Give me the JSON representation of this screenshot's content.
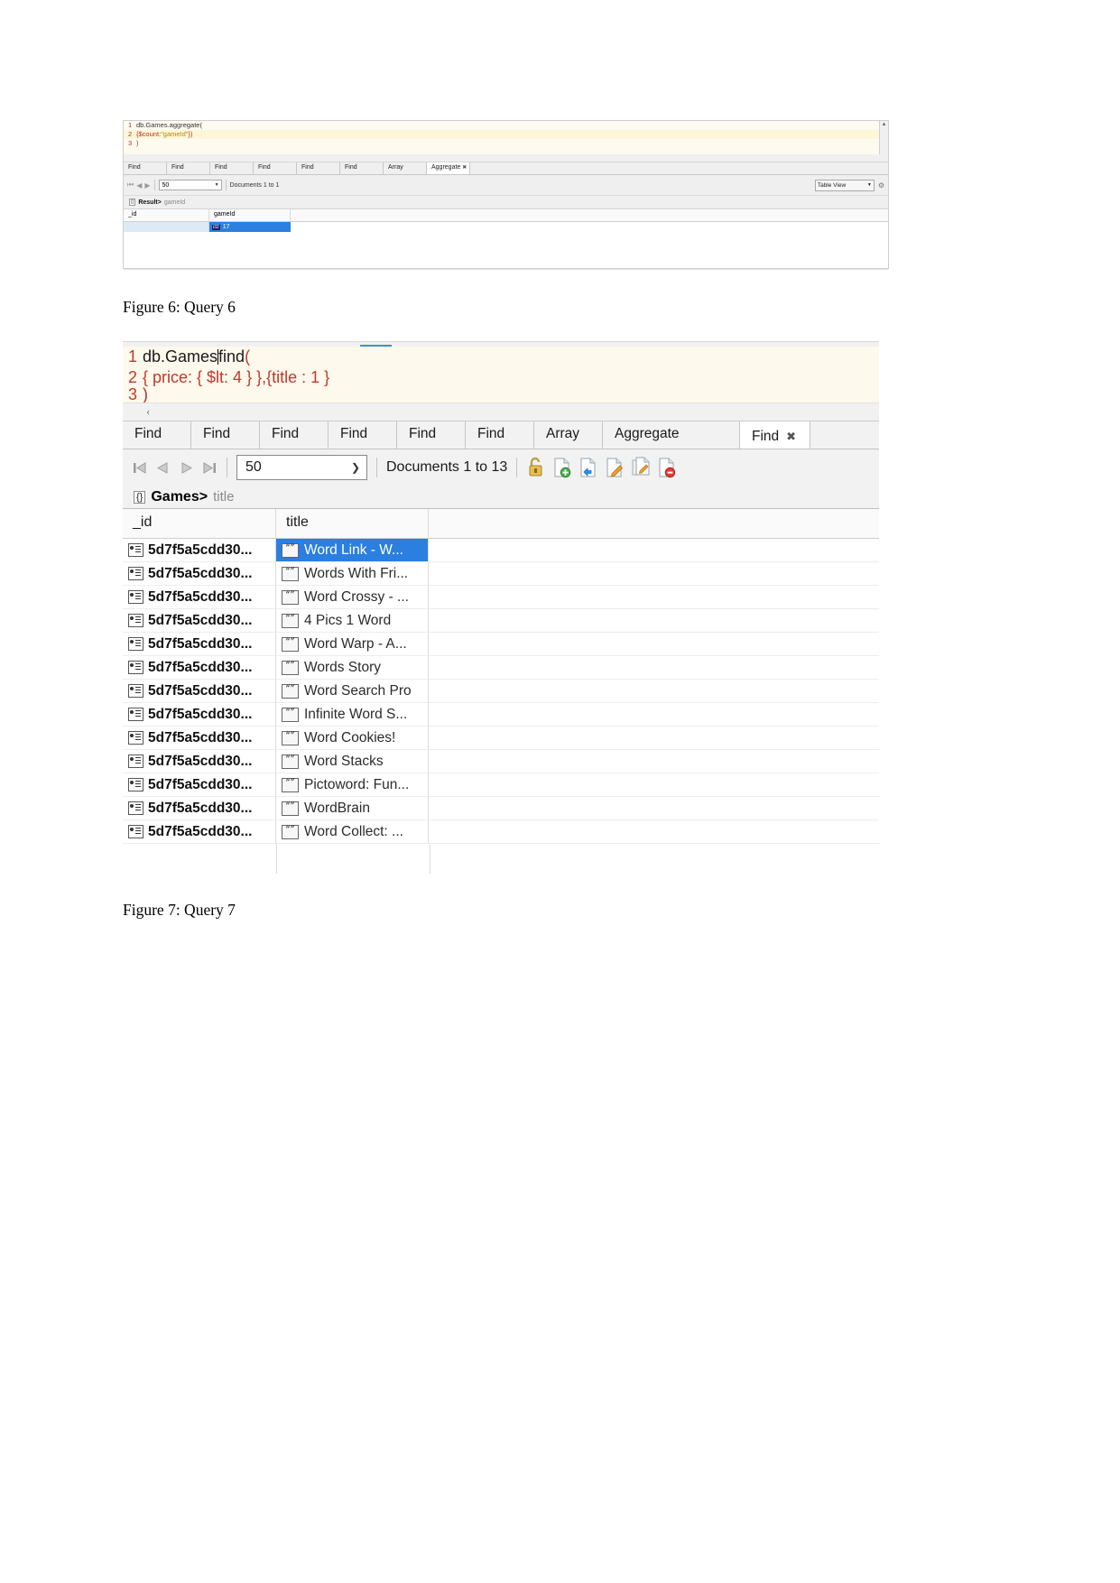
{
  "figure6": {
    "editor": {
      "line1_number": "1",
      "line1_text": "db.Games.aggregate(",
      "line2_number": "2",
      "line2_prefix": "{$count:",
      "line2_string": "\"gameId\"",
      "line2_suffix": "})",
      "line3_number": "3",
      "line3_text": ")"
    },
    "tabs": [
      {
        "label": "Find",
        "active": false
      },
      {
        "label": "Find",
        "active": false
      },
      {
        "label": "Find",
        "active": false
      },
      {
        "label": "Find",
        "active": false
      },
      {
        "label": "Find",
        "active": false
      },
      {
        "label": "Find",
        "active": false
      },
      {
        "label": "Array",
        "active": false
      },
      {
        "label": "Aggregate",
        "active": true,
        "close_icon": "close-icon"
      }
    ],
    "toolbar": {
      "first_icon": "first-page-icon",
      "prev_icon": "previous-page-icon",
      "next_icon": "next-page-icon",
      "page_size": "50",
      "documents_label": "Documents 1 to 1",
      "view_mode": "Table View",
      "gear_icon": "gear-icon"
    },
    "breadcrumb": {
      "type_icon": "{}",
      "collection": "Result>",
      "field": "gameId"
    },
    "grid": {
      "columns": [
        "_id",
        "gameId"
      ],
      "rows": [
        {
          "id": "",
          "type_badge": "i32",
          "value": "17",
          "selected": true
        }
      ]
    }
  },
  "caption6": "Figure 6: Query 6",
  "figure7": {
    "editor": {
      "line1_number": "1",
      "line1_text_a": "db.Games",
      "line1_text_b": "find",
      "line1_paren": "(",
      "line2_number": "2",
      "line2_text": "{ price: { $lt: 4 } },{title : 1 }",
      "line3_number": "3",
      "line3_text": ")",
      "scroll_chevron": "chevron-left-icon"
    },
    "tabs": [
      {
        "label": "Find",
        "active": false
      },
      {
        "label": "Find",
        "active": false
      },
      {
        "label": "Find",
        "active": false
      },
      {
        "label": "Find",
        "active": false
      },
      {
        "label": "Find",
        "active": false
      },
      {
        "label": "Find",
        "active": false
      },
      {
        "label": "Array",
        "active": false
      },
      {
        "label": "Aggregate",
        "active": false
      },
      {
        "label": "Find",
        "active": true,
        "close_icon": "close-icon"
      }
    ],
    "toolbar": {
      "first_icon": "first-page-icon",
      "prev_icon": "previous-page-icon",
      "next_icon": "next-page-icon",
      "last_icon": "last-page-icon",
      "page_size": "50",
      "documents_label": "Documents 1 to 13",
      "actions": [
        {
          "icon": "unlock-padlock-icon"
        },
        {
          "icon": "add-document-icon"
        },
        {
          "icon": "clone-document-icon"
        },
        {
          "icon": "edit-document-icon"
        },
        {
          "icon": "copy-document-icon"
        },
        {
          "icon": "delete-document-icon"
        }
      ]
    },
    "breadcrumb": {
      "type_icon": "{}",
      "collection": "Games>",
      "field": "title"
    },
    "grid": {
      "columns": [
        "_id",
        "title"
      ],
      "rows": [
        {
          "id": "5d7f5a5cdd30...",
          "title": "Word Link - W...",
          "selected": true
        },
        {
          "id": "5d7f5a5cdd30...",
          "title": "Words With Fri...",
          "selected": false
        },
        {
          "id": "5d7f5a5cdd30...",
          "title": "Word Crossy - ...",
          "selected": false
        },
        {
          "id": "5d7f5a5cdd30...",
          "title": "4 Pics 1 Word",
          "selected": false
        },
        {
          "id": "5d7f5a5cdd30...",
          "title": "Word Warp - A...",
          "selected": false
        },
        {
          "id": "5d7f5a5cdd30...",
          "title": "Words Story",
          "selected": false
        },
        {
          "id": "5d7f5a5cdd30...",
          "title": "Word Search Pro",
          "selected": false
        },
        {
          "id": "5d7f5a5cdd30...",
          "title": "Infinite Word S...",
          "selected": false
        },
        {
          "id": "5d7f5a5cdd30...",
          "title": "Word Cookies!",
          "selected": false
        },
        {
          "id": "5d7f5a5cdd30...",
          "title": "Word Stacks",
          "selected": false
        },
        {
          "id": "5d7f5a5cdd30...",
          "title": "Pictoword: Fun...",
          "selected": false
        },
        {
          "id": "5d7f5a5cdd30...",
          "title": "WordBrain",
          "selected": false
        },
        {
          "id": "5d7f5a5cdd30...",
          "title": "Word Collect: ...",
          "selected": false
        }
      ]
    }
  },
  "caption7": "Figure 7: Query 7",
  "colors": {
    "selection_blue": "#2a7fe0",
    "editor_background": "#fdf9ec",
    "toolbar_gray": "#f2f2f2",
    "line_number_red": "#c0392b"
  }
}
